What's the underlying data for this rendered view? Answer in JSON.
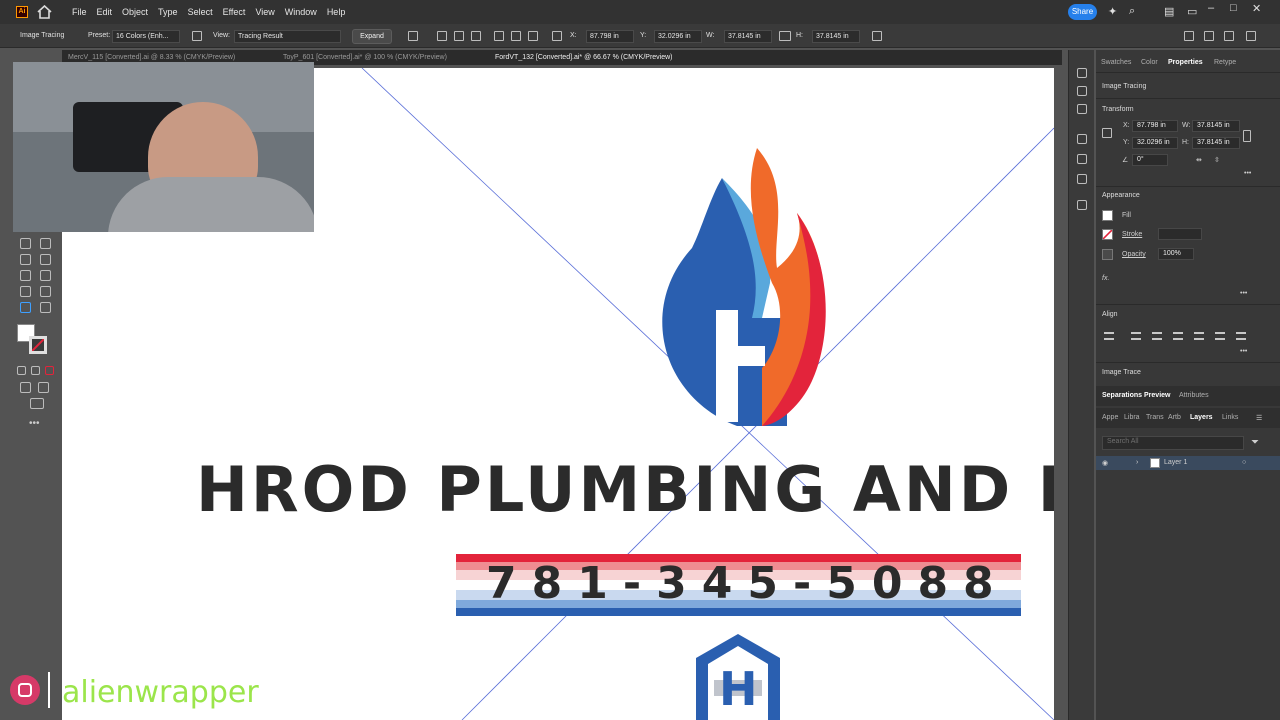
{
  "app": {
    "logo_text": "Ai",
    "menu": [
      "File",
      "Edit",
      "Object",
      "Type",
      "Select",
      "Effect",
      "View",
      "Window",
      "Help"
    ],
    "share_label": "Share"
  },
  "control_bar": {
    "mode_label": "Image Tracing",
    "preset_label": "Preset:",
    "preset_value": "16 Colors (Enh...",
    "view_label": "View:",
    "view_value": "Tracing Result",
    "expand_label": "Expand",
    "x_label": "X:",
    "x_value": "87.798 in",
    "y_label": "Y:",
    "y_value": "32.0296 in",
    "w_label": "W:",
    "w_value": "37.8145 in",
    "h_label": "H:",
    "h_value": "37.8145 in"
  },
  "doc_tabs": [
    {
      "label": "MercV_115 [Converted].ai @ 8.33 % (CMYK/Preview)"
    },
    {
      "label": "ToyP_601 [Converted].ai* @ 100 % (CMYK/Preview)"
    },
    {
      "label": "FordVT_132 [Converted].ai* @ 66.67 % (CMYK/Preview)"
    }
  ],
  "canvas": {
    "headline": "HROD PLUMBING AND HE",
    "phone": "781-345-5088",
    "logo_letter": "H"
  },
  "overlay": {
    "handle": "alienwrapper"
  },
  "right_panel": {
    "tabs": [
      "Swatches",
      "Color",
      "Properties",
      "Retype"
    ],
    "active_tab": "Properties",
    "section_image_tracing": "Image Tracing",
    "transform": {
      "title": "Transform",
      "x_label": "X:",
      "x_value": "87.798 in",
      "y_label": "Y:",
      "y_value": "32.0296 in",
      "w_label": "W:",
      "w_value": "37.8145 in",
      "h_label": "H:",
      "h_value": "37.8145 in",
      "angle_value": "0°"
    },
    "appearance": {
      "title": "Appearance",
      "fill_label": "Fill",
      "stroke_label": "Stroke",
      "opacity_label": "Opacity",
      "opacity_value": "100%",
      "fx_label": "fx."
    },
    "align_title": "Align",
    "image_trace_title": "Image Trace",
    "lower_tabs": [
      "Separations Preview",
      "Attributes"
    ],
    "layer_tabs": [
      "Appe",
      "Libra",
      "Trans",
      "Artb",
      "Layers",
      "Links"
    ],
    "active_layer_tab": "Layers",
    "search_placeholder": "Search All",
    "layer_name": "Layer 1"
  },
  "colors": {
    "flame_red": "#e3243b",
    "flame_orange": "#f06a2a",
    "flame_blue": "#2a5fb0",
    "text_dark": "#2b2b2b",
    "accent_share": "#2680eb"
  }
}
